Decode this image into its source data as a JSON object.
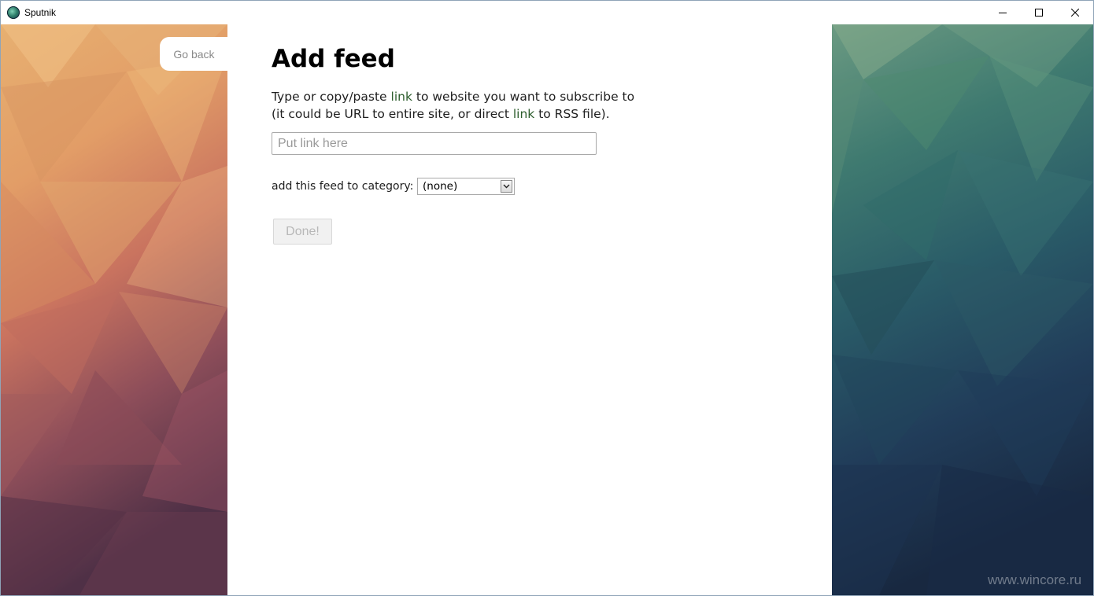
{
  "window": {
    "title": "Sputnik",
    "icon": "sputnik-globe-icon",
    "controls": {
      "minimize": "minimize-icon",
      "maximize": "maximize-icon",
      "close": "close-icon"
    }
  },
  "nav": {
    "go_back_label": "Go back"
  },
  "main": {
    "title": "Add feed",
    "description_line1_a": "Type or copy/paste ",
    "description_line1_link": "link",
    "description_line1_b": " to website you want to subscribe to",
    "description_line2_a": "(it could be URL to entire site, or direct ",
    "description_line2_link": "link",
    "description_line2_b": " to RSS file).",
    "link_input": {
      "value": "",
      "placeholder": "Put link here"
    },
    "category_label": "add this feed to category:",
    "category_select": {
      "selected": "(none)"
    },
    "done_label": "Done!"
  },
  "watermark": "www.wincore.ru",
  "colors": {
    "link_word": "#2c5d2c",
    "left_panel_top": "#e0a868",
    "left_panel_bottom": "#5a3848",
    "right_panel_top": "#5d8a78",
    "right_panel_bottom": "#1a2c48",
    "done_disabled_text": "#b8b8b8"
  }
}
